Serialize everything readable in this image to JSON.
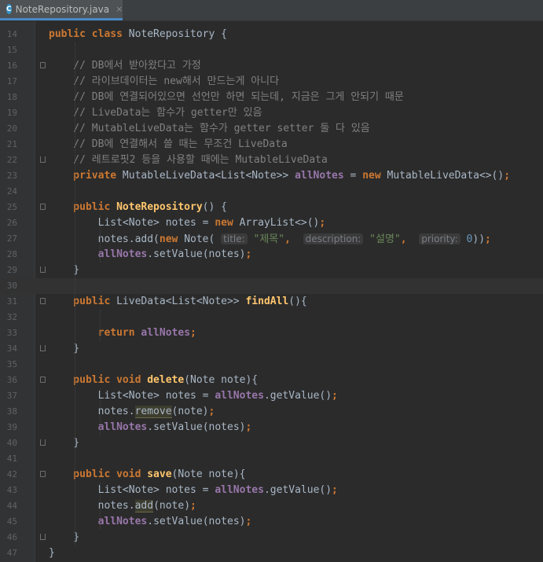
{
  "tab": {
    "icon_letter": "C",
    "filename": "NoteRepository.java",
    "close": "×"
  },
  "colors": {
    "background": "#2b2b2b",
    "keyword": "#cc7832",
    "field": "#9876aa",
    "method": "#ffc66d",
    "string": "#6a8759",
    "number": "#6897bb",
    "comment": "#808080",
    "plain": "#a9b7c6"
  },
  "lines": [
    {
      "n": "14",
      "fold": "none",
      "tokens": [
        {
          "t": "public class ",
          "c": "kw"
        },
        {
          "t": "NoteRepository {",
          "c": "pl"
        }
      ]
    },
    {
      "n": "15",
      "fold": "none",
      "tokens": []
    },
    {
      "n": "16",
      "fold": "start",
      "tokens": [
        {
          "t": "    // DB에서 받아왔다고 가정",
          "c": "cm"
        }
      ]
    },
    {
      "n": "17",
      "fold": "none",
      "tokens": [
        {
          "t": "    // 라이브데이터는 new해서 만드는게 아니다",
          "c": "cm"
        }
      ]
    },
    {
      "n": "18",
      "fold": "none",
      "tokens": [
        {
          "t": "    // DB에 연결되어있으면 선언만 하면 되는데, 지금은 그게 안되기 때문",
          "c": "cm"
        }
      ]
    },
    {
      "n": "19",
      "fold": "none",
      "tokens": [
        {
          "t": "    // LiveData는 함수가 getter만 있음",
          "c": "cm"
        }
      ]
    },
    {
      "n": "20",
      "fold": "none",
      "tokens": [
        {
          "t": "    // MutableLiveData는 함수가 getter setter 둘 다 있음",
          "c": "cm"
        }
      ]
    },
    {
      "n": "21",
      "fold": "none",
      "tokens": [
        {
          "t": "    // DB에 연결해서 쓸 때는 무조건 LiveData",
          "c": "cm"
        }
      ]
    },
    {
      "n": "22",
      "fold": "end",
      "tokens": [
        {
          "t": "    // 레트로핏2 등을 사용할 때에는 MutableLiveData",
          "c": "cm"
        }
      ]
    },
    {
      "n": "23",
      "fold": "none",
      "tokens": [
        {
          "t": "    private ",
          "c": "kw"
        },
        {
          "t": "MutableLiveData<List<Note>> ",
          "c": "pl"
        },
        {
          "t": "allNotes",
          "c": "fd"
        },
        {
          "t": " = ",
          "c": "pl"
        },
        {
          "t": "new ",
          "c": "kw"
        },
        {
          "t": "MutableLiveData<>()",
          "c": "pl"
        },
        {
          "t": ";",
          "c": "kw"
        }
      ]
    },
    {
      "n": "24",
      "fold": "none",
      "tokens": []
    },
    {
      "n": "25",
      "fold": "start",
      "tokens": [
        {
          "t": "    public ",
          "c": "kw"
        },
        {
          "t": "NoteRepository",
          "c": "fn"
        },
        {
          "t": "() {",
          "c": "pl"
        }
      ]
    },
    {
      "n": "26",
      "fold": "none",
      "tokens": [
        {
          "t": "        List<Note> notes = ",
          "c": "pl"
        },
        {
          "t": "new ",
          "c": "kw"
        },
        {
          "t": "ArrayList<>()",
          "c": "pl"
        },
        {
          "t": ";",
          "c": "kw"
        }
      ]
    },
    {
      "n": "27",
      "fold": "none",
      "tokens": [
        {
          "t": "        notes.add(",
          "c": "pl"
        },
        {
          "t": "new ",
          "c": "kw"
        },
        {
          "t": "Note( ",
          "c": "pl"
        },
        {
          "t": "title:",
          "c": "hint"
        },
        {
          "t": " \"제목\"",
          "c": "str"
        },
        {
          "t": ",  ",
          "c": "kw"
        },
        {
          "t": "description:",
          "c": "hint"
        },
        {
          "t": " \"설명\"",
          "c": "str"
        },
        {
          "t": ",  ",
          "c": "kw"
        },
        {
          "t": "priority:",
          "c": "hint"
        },
        {
          "t": " 0",
          "c": "num"
        },
        {
          "t": "))",
          "c": "pl"
        },
        {
          "t": ";",
          "c": "kw"
        }
      ]
    },
    {
      "n": "28",
      "fold": "none",
      "tokens": [
        {
          "t": "        ",
          "c": "pl"
        },
        {
          "t": "allNotes",
          "c": "fd"
        },
        {
          "t": ".setValue(notes)",
          "c": "pl"
        },
        {
          "t": ";",
          "c": "kw"
        }
      ]
    },
    {
      "n": "29",
      "fold": "end",
      "tokens": [
        {
          "t": "    }",
          "c": "pl"
        }
      ]
    },
    {
      "n": "30",
      "fold": "none",
      "current": true,
      "tokens": []
    },
    {
      "n": "31",
      "fold": "start",
      "tokens": [
        {
          "t": "    public ",
          "c": "kw"
        },
        {
          "t": "LiveData<List<Note>> ",
          "c": "pl"
        },
        {
          "t": "findAll",
          "c": "fn"
        },
        {
          "t": "(){",
          "c": "pl"
        }
      ]
    },
    {
      "n": "32",
      "fold": "none",
      "tokens": []
    },
    {
      "n": "33",
      "fold": "none",
      "tokens": [
        {
          "t": "        return ",
          "c": "kw"
        },
        {
          "t": "allNotes",
          "c": "fd"
        },
        {
          "t": ";",
          "c": "kw"
        }
      ]
    },
    {
      "n": "34",
      "fold": "end",
      "tokens": [
        {
          "t": "    }",
          "c": "pl"
        }
      ]
    },
    {
      "n": "35",
      "fold": "none",
      "tokens": []
    },
    {
      "n": "36",
      "fold": "start",
      "tokens": [
        {
          "t": "    public void ",
          "c": "kw"
        },
        {
          "t": "delete",
          "c": "fn"
        },
        {
          "t": "(Note note){",
          "c": "pl"
        }
      ]
    },
    {
      "n": "37",
      "fold": "none",
      "tokens": [
        {
          "t": "        List<Note> notes = ",
          "c": "pl"
        },
        {
          "t": "allNotes",
          "c": "fd"
        },
        {
          "t": ".getValue()",
          "c": "pl"
        },
        {
          "t": ";",
          "c": "kw"
        }
      ]
    },
    {
      "n": "38",
      "fold": "none",
      "tokens": [
        {
          "t": "        notes.",
          "c": "pl"
        },
        {
          "t": "remove",
          "c": "pl hl"
        },
        {
          "t": "(note)",
          "c": "pl"
        },
        {
          "t": ";",
          "c": "kw"
        }
      ]
    },
    {
      "n": "39",
      "fold": "none",
      "tokens": [
        {
          "t": "        ",
          "c": "pl"
        },
        {
          "t": "allNotes",
          "c": "fd"
        },
        {
          "t": ".setValue(notes)",
          "c": "pl"
        },
        {
          "t": ";",
          "c": "kw"
        }
      ]
    },
    {
      "n": "40",
      "fold": "end",
      "tokens": [
        {
          "t": "    }",
          "c": "pl"
        }
      ]
    },
    {
      "n": "41",
      "fold": "none",
      "tokens": []
    },
    {
      "n": "42",
      "fold": "start",
      "tokens": [
        {
          "t": "    public void ",
          "c": "kw"
        },
        {
          "t": "save",
          "c": "fn"
        },
        {
          "t": "(Note note){",
          "c": "pl"
        }
      ]
    },
    {
      "n": "43",
      "fold": "none",
      "tokens": [
        {
          "t": "        List<Note> notes = ",
          "c": "pl"
        },
        {
          "t": "allNotes",
          "c": "fd"
        },
        {
          "t": ".getValue()",
          "c": "pl"
        },
        {
          "t": ";",
          "c": "kw"
        }
      ]
    },
    {
      "n": "44",
      "fold": "none",
      "tokens": [
        {
          "t": "        notes.",
          "c": "pl"
        },
        {
          "t": "add",
          "c": "pl hl"
        },
        {
          "t": "(note)",
          "c": "pl"
        },
        {
          "t": ";",
          "c": "kw"
        }
      ]
    },
    {
      "n": "45",
      "fold": "none",
      "tokens": [
        {
          "t": "        ",
          "c": "pl"
        },
        {
          "t": "allNotes",
          "c": "fd"
        },
        {
          "t": ".setValue(notes)",
          "c": "pl"
        },
        {
          "t": ";",
          "c": "kw"
        }
      ]
    },
    {
      "n": "46",
      "fold": "end",
      "tokens": [
        {
          "t": "    }",
          "c": "pl"
        }
      ]
    },
    {
      "n": "47",
      "fold": "none",
      "tokens": [
        {
          "t": "}",
          "c": "pl"
        }
      ]
    }
  ]
}
